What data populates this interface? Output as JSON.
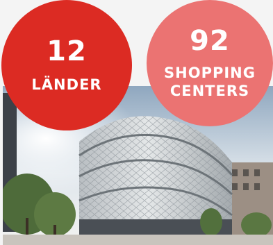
{
  "stats": [
    {
      "number": "12",
      "label_line1": "LÄNDER",
      "label_line2": "",
      "color": "#dc2b23"
    },
    {
      "number": "92",
      "label_line1": "SHOPPING",
      "label_line2": "CENTERS",
      "color": "#eb7372"
    }
  ],
  "photo": {
    "subject": "shopping-center-building-photo"
  }
}
